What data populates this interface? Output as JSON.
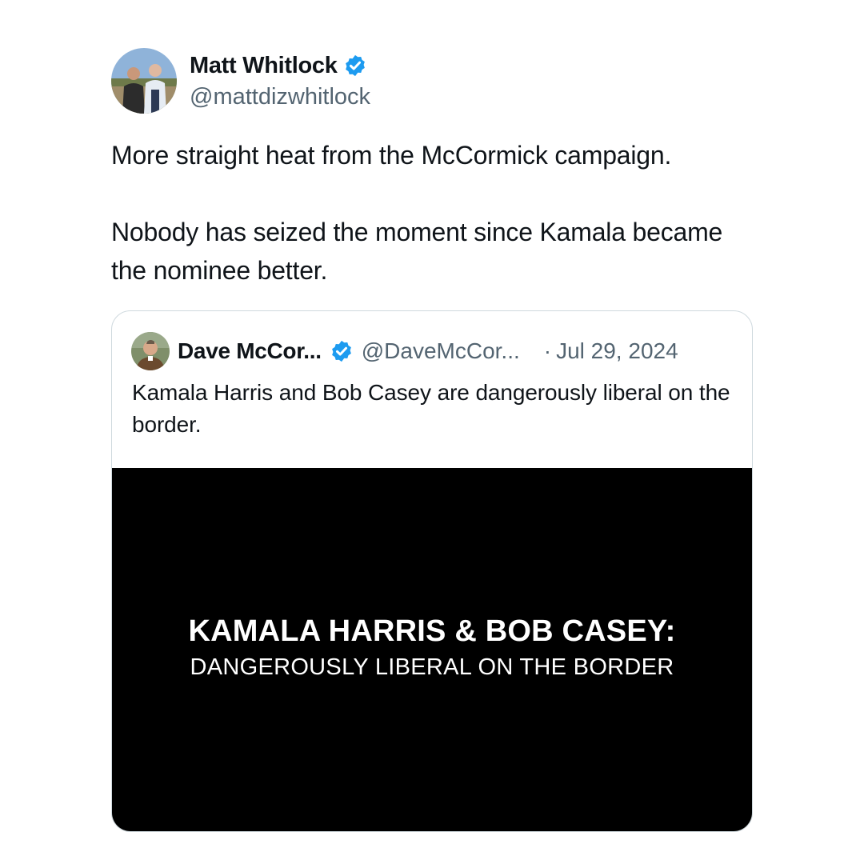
{
  "author": {
    "name": "Matt Whitlock",
    "handle": "@mattdizwhitlock",
    "avatar_icon": "profile-photo-icon",
    "verified_icon": "verified-badge-icon"
  },
  "tweet": {
    "paragraphs": [
      "More straight heat from the McCormick campaign.",
      "Nobody has seized the moment since Kamala became the nominee better."
    ]
  },
  "quote": {
    "name": "Dave McCor...",
    "handle": "@DaveMcCor...",
    "separator": "·",
    "date": "Jul 29, 2024",
    "text": "Kamala Harris and Bob Casey are dangerously liberal on the border.",
    "media": {
      "title": "KAMALA HARRIS & BOB CASEY:",
      "subtitle": "DANGEROUSLY LIBERAL ON THE BORDER"
    }
  },
  "colors": {
    "verified": "#1d9bf0",
    "text": "#0f1419",
    "secondary": "#536471",
    "border": "#cfd9de",
    "media_bg": "#000000"
  }
}
